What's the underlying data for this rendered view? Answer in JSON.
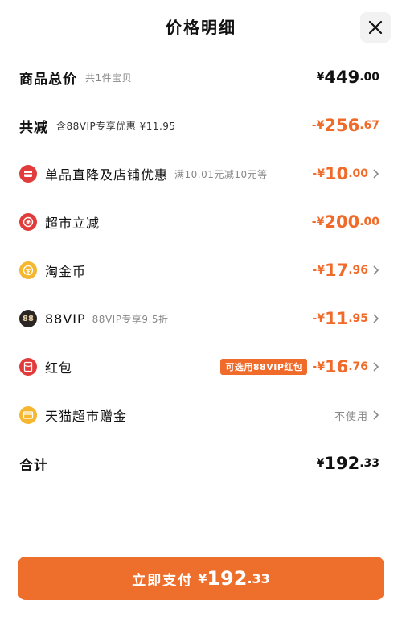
{
  "header": {
    "title": "价格明细",
    "close_icon": "close-icon"
  },
  "rows": {
    "subtotal": {
      "label": "商品总价",
      "note": "共1件宝贝",
      "currency": "¥",
      "int": "449",
      "dec": ".00"
    },
    "discount_total": {
      "label": "共减",
      "note": "含88VIP专享优惠 ¥11.95",
      "currency": "-¥",
      "int": "256",
      "dec": ".67"
    },
    "item_discount": {
      "label": "单品直降及店铺优惠",
      "note": "满10.01元减10元等",
      "currency": "-¥",
      "int": "10",
      "dec": ".00",
      "icon": "shop-discount-icon"
    },
    "supermarket": {
      "label": "超市立减",
      "currency": "-¥",
      "int": "200",
      "dec": ".00",
      "icon": "yen-refresh-icon"
    },
    "taojinbi": {
      "label": "淘金币",
      "currency": "-¥",
      "int": "17",
      "dec": ".96",
      "icon": "coin-icon"
    },
    "vip88": {
      "label": "88VIP",
      "note": "88VIP专享9.5折",
      "currency": "-¥",
      "int": "11",
      "dec": ".95",
      "icon": "vip88-icon",
      "icon_text": "88"
    },
    "redpacket": {
      "label": "红包",
      "badge": "可选用88VIP红包",
      "currency": "-¥",
      "int": "16",
      "dec": ".76",
      "icon": "red-packet-icon"
    },
    "gift_money": {
      "label": "天猫超市赠金",
      "value": "不使用",
      "icon": "gift-card-icon"
    },
    "total": {
      "label": "合计",
      "currency": "¥",
      "int": "192",
      "dec": ".33"
    }
  },
  "footer": {
    "pay_label": "立即支付",
    "currency": "¥",
    "int": "192",
    "dec": ".33"
  },
  "colors": {
    "accent": "#ee6e2c",
    "text": "#111111",
    "muted": "#888888",
    "red_icon": "#e23b3b",
    "gold_icon": "#f5b630"
  }
}
